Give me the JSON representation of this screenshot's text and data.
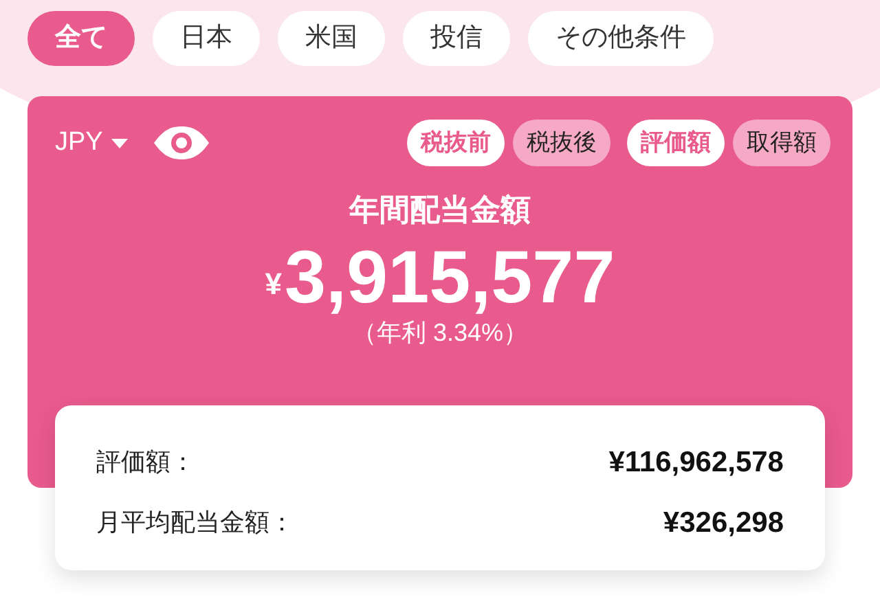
{
  "filters": [
    {
      "label": "全て",
      "selected": true
    },
    {
      "label": "日本",
      "selected": false
    },
    {
      "label": "米国",
      "selected": false
    },
    {
      "label": "投信",
      "selected": false
    },
    {
      "label": "その他条件",
      "selected": false
    }
  ],
  "summary": {
    "currency": "JPY",
    "tax_toggle": [
      {
        "label": "税抜前",
        "selected": true
      },
      {
        "label": "税抜後",
        "selected": false
      }
    ],
    "basis_toggle": [
      {
        "label": "評価額",
        "selected": true
      },
      {
        "label": "取得額",
        "selected": false
      }
    ],
    "title": "年間配当金額",
    "currency_symbol": "¥",
    "amount": "3,915,577",
    "yield": "（年利 3.34%）",
    "details": [
      {
        "label": "評価額：",
        "value": "¥116,962,578"
      },
      {
        "label": "月平均配当金額：",
        "value": "¥326,298"
      }
    ]
  }
}
